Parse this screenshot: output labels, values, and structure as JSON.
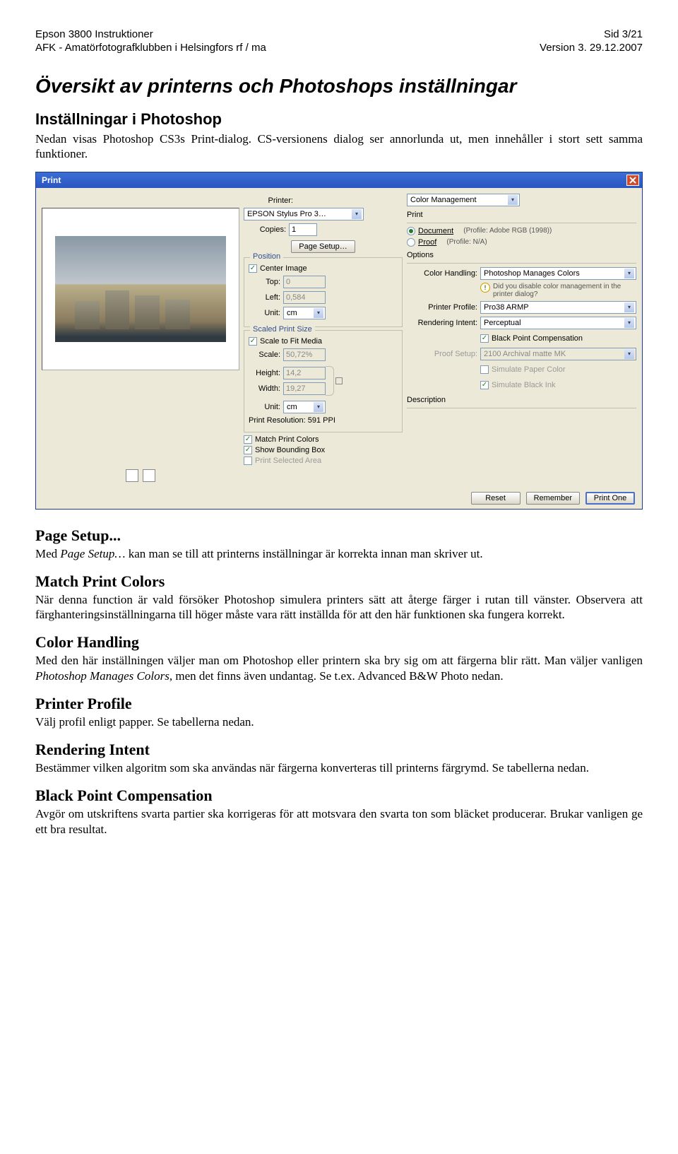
{
  "header": {
    "left1": "Epson 3800 Instruktioner",
    "left2": "AFK - Amatörfotografklubben i Helsingfors rf / ma",
    "right1": "Sid 3/21",
    "right2": "Version 3. 29.12.2007"
  },
  "doc": {
    "h1": "Översikt av printerns och Photoshops inställningar",
    "h2a": "Inställningar i Photoshop",
    "p1": "Nedan visas Photoshop CS3s Print-dialog. CS-versionens dialog ser annorlunda ut, men innehåller i stort sett samma funktioner.",
    "h3a": "Page Setup...",
    "p2a": "Med ",
    "p2i": "Page Setup…",
    "p2b": " kan man se till att printerns inställningar är korrekta innan man skriver ut.",
    "h3b": "Match Print Colors",
    "p3": "När denna function är vald försöker Photoshop simulera printers sätt att återge färger i rutan till vänster. Observera att färghanteringsinställningarna till höger måste vara rätt inställda för att den här funktionen ska fungera korrekt.",
    "h3c": "Color Handling",
    "p4a": "Med den här inställningen väljer man om Photoshop eller printern ska bry sig om att färgerna blir rätt. Man väljer vanligen ",
    "p4i": "Photoshop Manages Colors",
    "p4b": ", men det finns även undantag. Se t.ex. Advanced B&W Photo nedan.",
    "h3d": "Printer Profile",
    "p5": "Välj profil enligt papper. Se tabellerna nedan.",
    "h3e": "Rendering Intent",
    "p6": "Bestämmer vilken algoritm som ska användas när färgerna konverteras till printerns färgrymd. Se tabellerna nedan.",
    "h3f": "Black Point Compensation",
    "p7": "Avgör om utskriftens svarta partier ska korrigeras för att motsvara den svarta ton som bläcket producerar. Brukar vanligen ge ett bra resultat."
  },
  "dlg": {
    "title": "Print",
    "printer_label": "Printer:",
    "printer_value": "EPSON Stylus Pro 3…",
    "copies_label": "Copies:",
    "copies_value": "1",
    "page_setup_btn": "Page Setup…",
    "position_legend": "Position",
    "center_image": "Center Image",
    "top_label": "Top:",
    "top_value": "0",
    "left_label": "Left:",
    "left_value": "0,584",
    "unit_label": "Unit:",
    "unit_value": "cm",
    "scaled_legend": "Scaled Print Size",
    "scale_to_fit": "Scale to Fit Media",
    "scale_label": "Scale:",
    "scale_value": "50,72%",
    "height_label": "Height:",
    "height_value": "14,2",
    "width_label": "Width:",
    "width_value": "19,27",
    "res_line": "Print Resolution: 591 PPI",
    "match_print": "Match Print Colors",
    "show_bbox": "Show Bounding Box",
    "print_sel": "Print Selected Area",
    "top_sel": "Color Management",
    "print_section": "Print",
    "doc_radio": "Document",
    "doc_profile": "(Profile: Adobe RGB (1998))",
    "proof_radio": "Proof",
    "proof_profile": "(Profile: N/A)",
    "options_lbl": "Options",
    "color_handling_lbl": "Color Handling:",
    "color_handling_val": "Photoshop Manages Colors",
    "warn_text": "Did you disable color management in the printer dialog?",
    "printer_profile_lbl": "Printer Profile:",
    "printer_profile_val": "Pro38 ARMP",
    "render_intent_lbl": "Rendering Intent:",
    "render_intent_val": "Perceptual",
    "bpc": "Black Point Compensation",
    "proof_setup_lbl": "Proof Setup:",
    "proof_setup_val": "2100 Archival matte MK",
    "sim_paper": "Simulate Paper Color",
    "sim_black": "Simulate Black Ink",
    "desc_lbl": "Description",
    "btn_reset": "Reset",
    "btn_remember": "Remember",
    "btn_printone": "Print One"
  }
}
